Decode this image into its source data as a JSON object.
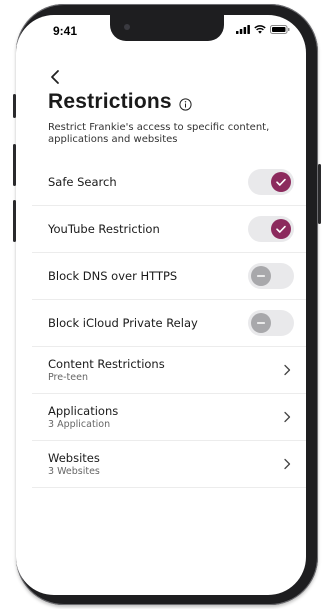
{
  "status_bar": {
    "time": "9:41",
    "icons": [
      "signal-icon",
      "wifi-icon",
      "battery-icon"
    ]
  },
  "header": {
    "back_icon": "chevron-left-icon",
    "title": "Restrictions",
    "info_icon": "info-icon",
    "subtitle": "Restrict Frankie's access to specific content, applications and websites"
  },
  "settings": {
    "safe_search": {
      "label": "Safe Search",
      "enabled": true
    },
    "youtube": {
      "label": "YouTube Restriction",
      "enabled": true
    },
    "block_dns": {
      "label": "Block DNS over HTTPS",
      "enabled": false
    },
    "block_icloud": {
      "label": "Block iCloud Private Relay",
      "enabled": false
    },
    "content": {
      "label": "Content Restrictions",
      "value": "Pre-teen"
    },
    "applications": {
      "label": "Applications",
      "value": "3 Application"
    },
    "websites": {
      "label": "Websites",
      "value": "3 Websites"
    }
  },
  "colors": {
    "accent": "#8c2a5d",
    "toggle_track": "#e9e9eb",
    "toggle_off_knob": "#a8a8ab",
    "divider": "#ececec"
  }
}
